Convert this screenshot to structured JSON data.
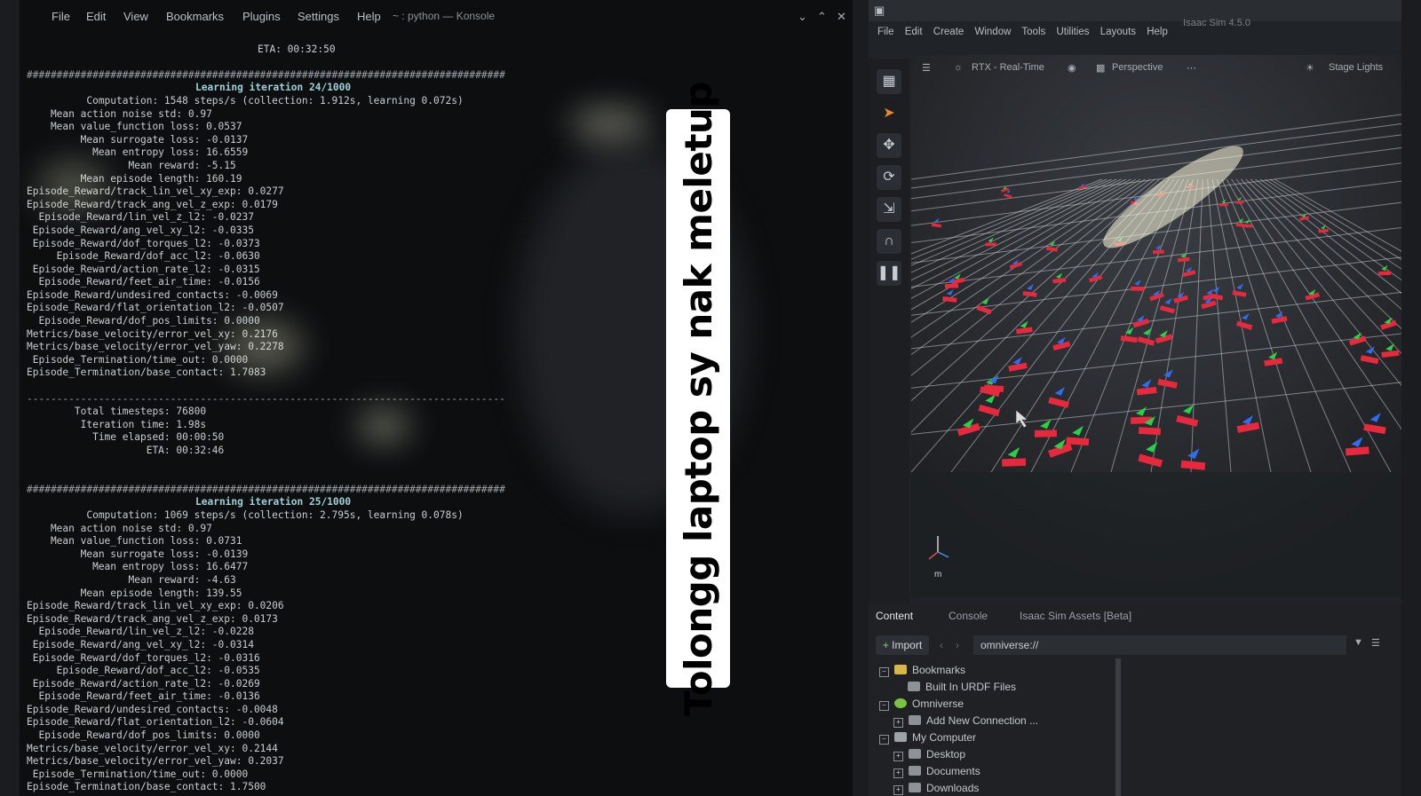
{
  "konsole": {
    "window_title": "~ : python — Konsole",
    "menu": [
      "File",
      "Edit",
      "View",
      "Bookmarks",
      "Plugins",
      "Settings",
      "Help"
    ],
    "top_eta": "ETA: 00:32:50",
    "iter24": {
      "header": "Learning iteration 24/1000",
      "lines": [
        "          Computation: 1548 steps/s (collection: 1.912s, learning 0.072s)",
        "    Mean action noise std: 0.97",
        "    Mean value_function loss: 0.0537",
        "         Mean surrogate loss: -0.0137",
        "           Mean entropy loss: 16.6559",
        "                 Mean reward: -5.15",
        "         Mean episode length: 160.19",
        "Episode_Reward/track_lin_vel_xy_exp: 0.0277",
        "Episode_Reward/track_ang_vel_z_exp: 0.0179",
        "  Episode_Reward/lin_vel_z_l2: -0.0237",
        " Episode_Reward/ang_vel_xy_l2: -0.0335",
        " Episode_Reward/dof_torques_l2: -0.0373",
        "     Episode_Reward/dof_acc_l2: -0.0630",
        " Episode_Reward/action_rate_l2: -0.0315",
        "  Episode_Reward/feet_air_time: -0.0156",
        "Episode_Reward/undesired_contacts: -0.0069",
        "Episode_Reward/flat_orientation_l2: -0.0507",
        "  Episode_Reward/dof_pos_limits: 0.0000",
        "Metrics/base_velocity/error_vel_xy: 0.2176",
        "Metrics/base_velocity/error_vel_yaw: 0.2278",
        " Episode_Termination/time_out: 0.0000",
        "Episode_Termination/base_contact: 1.7083"
      ],
      "summary": [
        "        Total timesteps: 76800",
        "         Iteration time: 1.98s",
        "           Time elapsed: 00:00:50",
        "                    ETA: 00:32:46"
      ]
    },
    "iter25": {
      "header": "Learning iteration 25/1000",
      "lines": [
        "          Computation: 1069 steps/s (collection: 2.795s, learning 0.078s)",
        "    Mean action noise std: 0.97",
        "    Mean value_function loss: 0.0731",
        "         Mean surrogate loss: -0.0139",
        "           Mean entropy loss: 16.6477",
        "                 Mean reward: -4.63",
        "         Mean episode length: 139.55",
        "Episode_Reward/track_lin_vel_xy_exp: 0.0206",
        "Episode_Reward/track_ang_vel_z_exp: 0.0173",
        "  Episode_Reward/lin_vel_z_l2: -0.0228",
        " Episode_Reward/ang_vel_xy_l2: -0.0314",
        " Episode_Reward/dof_torques_l2: -0.0316",
        "     Episode_Reward/dof_acc_l2: -0.0535",
        " Episode_Reward/action_rate_l2: -0.0269",
        "  Episode_Reward/feet_air_time: -0.0136",
        "Episode_Reward/undesired_contacts: -0.0048",
        "Episode_Reward/flat_orientation_l2: -0.0604",
        "  Episode_Reward/dof_pos_limits: 0.0000",
        "Metrics/base_velocity/error_vel_xy: 0.2144",
        "Metrics/base_velocity/error_vel_yaw: 0.2037",
        " Episode_Termination/time_out: 0.0000",
        "Episode_Termination/base_contact: 1.7500"
      ]
    }
  },
  "caption": "Tolongg laptop sy nak meletup",
  "isaac": {
    "app_title": "Isaac Sim 4.5.0",
    "menu": [
      "File",
      "Edit",
      "Create",
      "Window",
      "Tools",
      "Utilities",
      "Layouts",
      "Help"
    ],
    "viewport": {
      "renderer": "RTX - Real-Time",
      "camera": "Perspective",
      "stage_lights": "Stage Lights",
      "unit": "m"
    },
    "tabs": [
      "Content",
      "Console",
      "Isaac Sim Assets [Beta]"
    ],
    "import_label": "Import",
    "path": "omniverse://",
    "tree": [
      {
        "label": "Bookmarks"
      },
      {
        "label": "Built In URDF Files"
      },
      {
        "label": "Omniverse"
      },
      {
        "label": "Add New Connection ..."
      },
      {
        "label": "My Computer"
      },
      {
        "label": "Desktop"
      },
      {
        "label": "Documents"
      },
      {
        "label": "Downloads"
      }
    ]
  }
}
